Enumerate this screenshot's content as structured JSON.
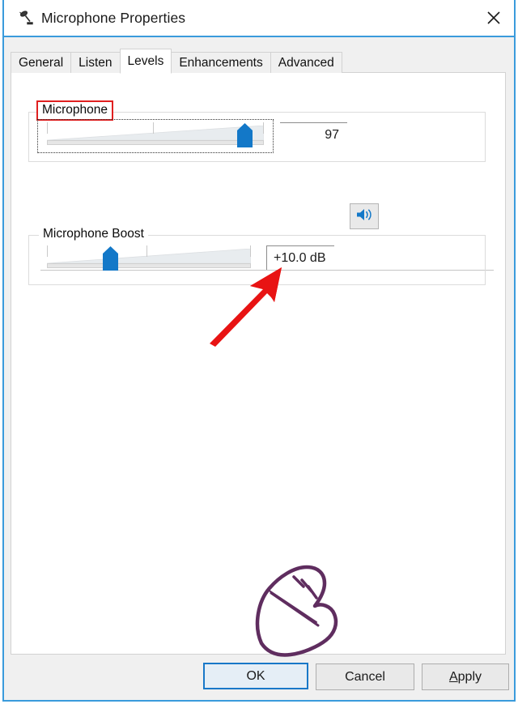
{
  "window": {
    "title": "Microphone Properties",
    "icon": "microphone-icon",
    "close_label": "✕",
    "accent_color": "#3a9bdc"
  },
  "tabs": [
    {
      "label": "General",
      "active": false
    },
    {
      "label": "Listen",
      "active": false
    },
    {
      "label": "Levels",
      "active": true
    },
    {
      "label": "Enhancements",
      "active": false
    },
    {
      "label": "Advanced",
      "active": false
    }
  ],
  "levels": {
    "microphone": {
      "legend": "Microphone",
      "legend_highlight_color": "#e02020",
      "value": "97",
      "slider_percent": 90,
      "focused": true,
      "mute_icon": "speaker-icon"
    },
    "microphone_boost": {
      "legend": "Microphone Boost",
      "value": "+10.0 dB",
      "slider_percent": 33,
      "focused": false
    }
  },
  "annotations": {
    "arrow": {
      "name": "red-arrow-annotation",
      "color": "#e81313"
    },
    "hand": {
      "name": "hand-cursor-annotation",
      "color": "#5f2d5f"
    }
  },
  "buttons": {
    "ok": "OK",
    "cancel": "Cancel",
    "apply_prefix": "A",
    "apply_rest": "pply"
  }
}
